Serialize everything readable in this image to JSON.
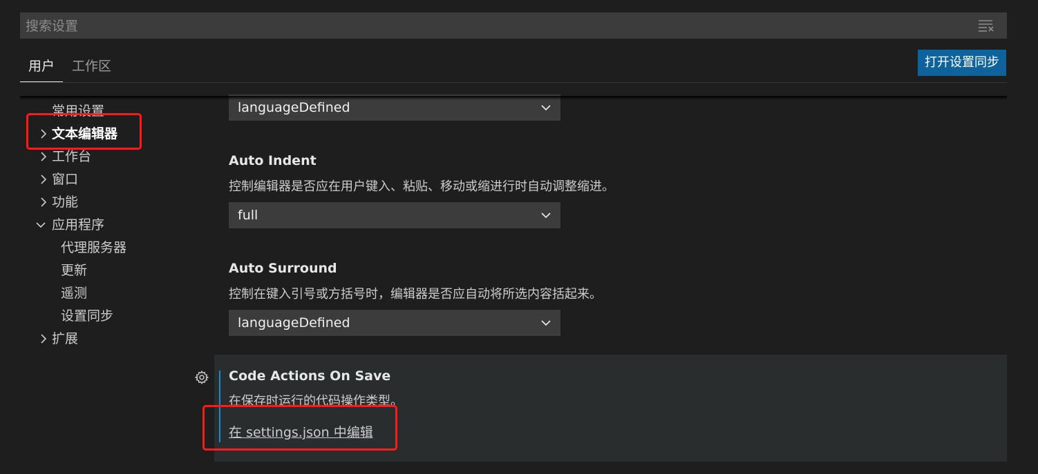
{
  "search": {
    "placeholder": "搜索设置",
    "clear_icon": "clear-filter-icon"
  },
  "tabs": [
    {
      "label": "用户",
      "active": true
    },
    {
      "label": "工作区",
      "active": false
    }
  ],
  "sync_button_label": "打开设置同步",
  "colors": {
    "background": "#1e1e1e",
    "accent_button": "#0e639c",
    "focus_indicator": "#1c89c9",
    "annotation_red": "#ff1a1a"
  },
  "toc": {
    "items": [
      {
        "label": "常用设置",
        "expandable": false
      },
      {
        "label": "文本编辑器",
        "expandable": true,
        "expanded": false,
        "selected": true
      },
      {
        "label": "工作台",
        "expandable": true,
        "expanded": false
      },
      {
        "label": "窗口",
        "expandable": true,
        "expanded": false
      },
      {
        "label": "功能",
        "expandable": true,
        "expanded": false
      },
      {
        "label": "应用程序",
        "expandable": true,
        "expanded": true
      },
      {
        "label": "扩展",
        "expandable": true,
        "expanded": false
      }
    ],
    "app_children": [
      "代理服务器",
      "更新",
      "遥测",
      "设置同步"
    ]
  },
  "settings": [
    {
      "title": "",
      "description": "",
      "value": "languageDefined"
    },
    {
      "title": "Auto Indent",
      "description": "控制编辑器是否应在用户键入、粘贴、移动或缩进行时自动调整缩进。",
      "value": "full"
    },
    {
      "title": "Auto Surround",
      "description": "控制在键入引号或方括号时，编辑器是否应自动将所选内容括起来。",
      "value": "languageDefined"
    },
    {
      "title": "Code Actions On Save",
      "description": "在保存时运行的代码操作类型。",
      "link": "在 settings.json 中编辑"
    }
  ]
}
